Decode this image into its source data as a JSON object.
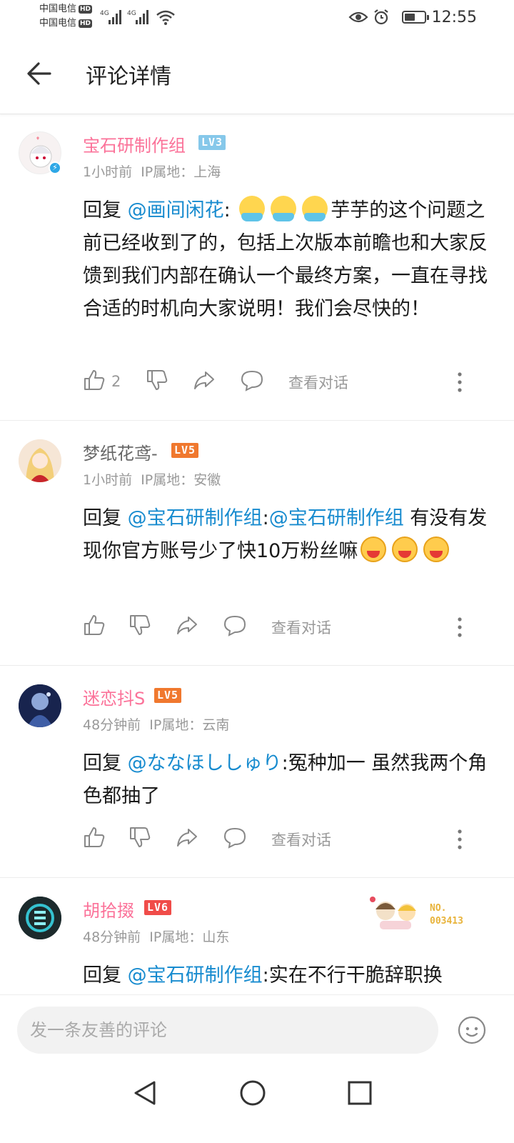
{
  "status_bar": {
    "carrier_1": "中国电信",
    "carrier_2": "中国电信",
    "hd": "HD",
    "network": "4G",
    "time": "12:55"
  },
  "header": {
    "title": "评论详情",
    "back_icon": "arrow-left-icon"
  },
  "colors": {
    "pink_name": "#fb7299",
    "link_blue": "#178bcf",
    "lv3": "#86c8ea",
    "lv5": "#f0782e",
    "lv6": "#f04c49"
  },
  "comments": [
    {
      "user": "宝石研制作组",
      "level": "LV3",
      "time": "1小时前",
      "ip": "IP属地：上海",
      "reply_prefix": "回复",
      "mention": "@画间闲花",
      "sep": ":",
      "text": "芋芋的这个问题之前已经收到了的，包括上次版本前瞻也和大家反馈到我们内部在确认一个最终方案，一直在寻找合适的时机向大家说明！我们会尽快的！",
      "likes": "2",
      "view_conversation": "查看对话"
    },
    {
      "user": "梦纸花鸢-",
      "level": "LV5",
      "time": "1小时前",
      "ip": "IP属地：安徽",
      "reply_prefix": "回复",
      "mention": "@宝石研制作组",
      "sep": ":",
      "mention_2": "@宝石研制作组",
      "text": "有没有发现你官方账号少了快10万粉丝嘛",
      "likes": "",
      "view_conversation": "查看对话"
    },
    {
      "user": "迷恋抖S",
      "level": "LV5",
      "time": "48分钟前",
      "ip": "IP属地：云南",
      "reply_prefix": "回复",
      "mention": "@ななほししゅり",
      "sep": ":",
      "text": "冤种加一  虽然我两个角色都抽了",
      "likes": "",
      "view_conversation": "查看对话"
    },
    {
      "user": "胡拾掇",
      "level": "LV6",
      "time": "48分钟前",
      "ip": "IP属地：山东",
      "reply_prefix": "回复",
      "mention": "@宝石研制作组",
      "sep": ":",
      "text": "实在不行干脆辞职换",
      "fan_badge_no": "NO.",
      "fan_badge_num": "003413"
    }
  ],
  "bottom_bar": {
    "input_placeholder": "发一条友善的评论",
    "emoji_icon": "emoji-face-icon"
  },
  "nav_bar": {
    "back": "nav-back-icon",
    "home": "nav-home-icon",
    "recents": "nav-recents-icon"
  }
}
